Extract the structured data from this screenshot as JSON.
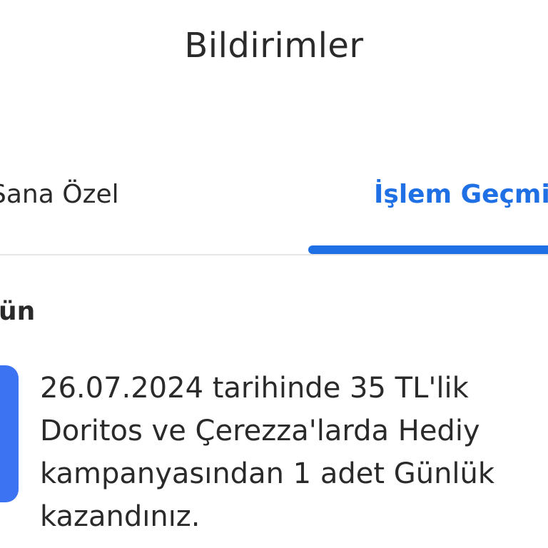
{
  "header": {
    "title": "Bildirimler"
  },
  "tabs": [
    {
      "label": "Sana Özel",
      "active": false
    },
    {
      "label": "İşlem Geçmi",
      "active": true
    }
  ],
  "colors": {
    "accent": "#1f6fe5",
    "icon_tile": "#3b73f2",
    "divider": "#e6e6e6",
    "text": "#2a2a2a"
  },
  "section": {
    "label": "ün"
  },
  "notifications": [
    {
      "icon": "blue-tile-icon",
      "text": "26.07.2024 tarihinde 35 TL'lik\nDoritos ve Çerezza'larda Hediy\nkampanyasından 1 adet Günlük\nkazandınız."
    }
  ]
}
